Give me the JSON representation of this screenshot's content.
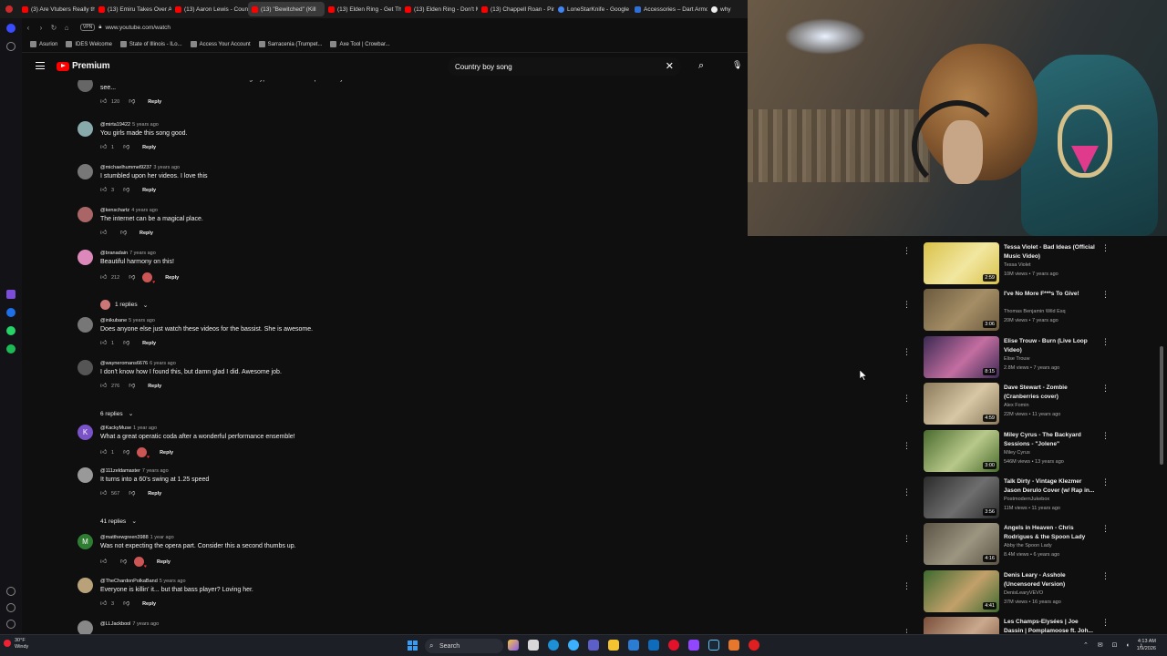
{
  "browser": {
    "tabs": [
      {
        "label": "(3) Are Vtubers Really the",
        "icon": "youtube"
      },
      {
        "label": "(13) Emiru Takes Over Ar",
        "icon": "youtube"
      },
      {
        "label": "(13) Aaron Lewis - Count",
        "icon": "youtube"
      },
      {
        "label": "(13) \"Bewitched\" (Kill",
        "icon": "youtube",
        "active": true
      },
      {
        "label": "(13) Elden Ring - Get Thes",
        "icon": "youtube"
      },
      {
        "label": "(13) Elden Ring - Don't Mi",
        "icon": "youtube"
      },
      {
        "label": "(13) Chappell Roan - Pink",
        "icon": "youtube"
      },
      {
        "label": "LoneStarKnife - Google S",
        "icon": "google"
      },
      {
        "label": "Accessories – Dart Armou",
        "icon": "site"
      },
      {
        "label": "why",
        "icon": "web"
      }
    ],
    "vpn_label": "VPN",
    "url": "www.youtube.com/watch",
    "bookmarks": [
      "Asurion",
      "IDES Welcome",
      "State of Illinois - ILo...",
      "Access Your Account",
      "Sarracenia (Trumpet...",
      "Axe Tool | Crowbar..."
    ]
  },
  "youtube": {
    "logo_text": "Premium",
    "search_value": "Country boy song"
  },
  "comments": [
    {
      "author": "",
      "ago": "",
      "text_lines": [
        "Them Dame's were throwin down a beat like a Chicago typewriter inside a speak easy at 2AM.",
        "see..."
      ],
      "likes": "120",
      "reply": "Reply",
      "hearted": false
    },
    {
      "author": "@mirta19422",
      "ago": "5 years ago",
      "text_lines": [
        "You girls made this song good."
      ],
      "likes": "1",
      "reply": "Reply",
      "hearted": false
    },
    {
      "author": "@michaelhummel9237",
      "ago": "3 years ago",
      "text_lines": [
        "I stumbled upon her videos. I love this"
      ],
      "likes": "3",
      "reply": "Reply",
      "hearted": false
    },
    {
      "author": "@kenschartz",
      "ago": "4 years ago",
      "text_lines": [
        "The internet can be a magical place."
      ],
      "likes": "",
      "reply": "Reply",
      "hearted": false
    },
    {
      "author": "@branadain",
      "ago": "7 years ago",
      "text_lines": [
        "Beautiful harmony on this!"
      ],
      "likes": "212",
      "reply": "Reply",
      "hearted": true,
      "replies": "1 replies"
    },
    {
      "author": "@inikubane",
      "ago": "5 years ago",
      "text_lines": [
        "Does anyone else just watch these videos for the bassist. She is awesome."
      ],
      "likes": "1",
      "reply": "Reply",
      "hearted": false
    },
    {
      "author": "@wayneromans6676",
      "ago": "6 years ago",
      "text_lines": [
        "I don't know how I found this, but damn glad I did. Awesome job."
      ],
      "likes": "276",
      "reply": "Reply",
      "hearted": false,
      "replies": "6 replies"
    },
    {
      "author": "@KackyMuse",
      "ago": "1 year ago",
      "text_lines": [
        "What a great operatic coda after a wonderful performance ensemble!"
      ],
      "likes": "1",
      "reply": "Reply",
      "hearted": true,
      "avatar_letter": "K"
    },
    {
      "author": "@111zeldamaster",
      "ago": "7 years ago",
      "text_lines": [
        "It turns into a 60's swing at 1.25 speed"
      ],
      "likes": "567",
      "reply": "Reply",
      "hearted": false,
      "replies": "41 replies"
    },
    {
      "author": "@matthewgreen3988",
      "ago": "1 year ago",
      "text_lines": [
        "Was not expecting the opera part. Consider this a second thumbs up."
      ],
      "likes": "",
      "reply": "Reply",
      "hearted": true,
      "avatar_letter": "M"
    },
    {
      "author": "@TheChardonPolkaBand",
      "ago": "5 years ago",
      "text_lines": [
        "Everyone is killin' it... but that bass player? Loving her."
      ],
      "likes": "3",
      "reply": "Reply",
      "hearted": false
    },
    {
      "author": "@LLJackbool",
      "ago": "7 years ago",
      "text_lines": [
        ""
      ],
      "likes": "",
      "reply": "",
      "hearted": false
    }
  ],
  "recommendations": [
    {
      "title": "Tessa Violet - Bad Ideas (Official Music Video)",
      "channel": "Tessa Violet",
      "verified": true,
      "meta": "10M views • 7 years ago",
      "duration": "2:59",
      "thumb_colors": [
        "#d9c24a",
        "#f2e7a1"
      ]
    },
    {
      "title": "I've No More F***s To Give!",
      "channel": "Thomas Benjamin Wild Esq",
      "verified": false,
      "meta": "20M views • 7 years ago",
      "duration": "3:06",
      "thumb_colors": [
        "#6b5a3e",
        "#a58e66"
      ]
    },
    {
      "title": "Elise Trouw - Burn (Live Loop Video)",
      "channel": "Elise Trouw",
      "verified": true,
      "meta": "2.8M views • 7 years ago",
      "duration": "8:15",
      "thumb_colors": [
        "#3b2a52",
        "#c46ea1"
      ]
    },
    {
      "title": "Dave Stewart - Zombie (Cranberries cover)",
      "channel": "Alex Fomin",
      "verified": false,
      "meta": "22M views • 11 years ago",
      "duration": "4:59",
      "thumb_colors": [
        "#8b7a5c",
        "#d8c7a4"
      ]
    },
    {
      "title": "Miley Cyrus - The Backyard Sessions - \"Jolene\"",
      "channel": "Miley Cyrus",
      "verified": true,
      "meta": "546M views • 13 years ago",
      "duration": "3:00",
      "thumb_colors": [
        "#4a6b2e",
        "#b8c98a"
      ]
    },
    {
      "title": "Talk Dirty - Vintage Klezmer Jason Derulo Cover (w/ Rap in...",
      "channel": "PostmodernJukebox",
      "verified": true,
      "meta": "11M views • 11 years ago",
      "duration": "3:56",
      "thumb_colors": [
        "#2b2b2b",
        "#6e6e6e"
      ]
    },
    {
      "title": "Angels in Heaven - Chris Rodrigues & the Spoon Lady",
      "channel": "Abby the Spoon Lady",
      "verified": true,
      "meta": "8.4M views • 6 years ago",
      "duration": "4:16",
      "thumb_colors": [
        "#5b5446",
        "#9c9580"
      ]
    },
    {
      "title": "Denis Leary - Asshole (Uncensored Version)",
      "channel": "DenisLearyVEVO",
      "verified": true,
      "meta": "37M views • 16 years ago",
      "duration": "4:41",
      "thumb_colors": [
        "#3e6a2f",
        "#c2a06a"
      ]
    },
    {
      "title": "Les Champs-Elysées | Joe Dassin | Pomplamoose ft. Joh...",
      "channel": "",
      "verified": false,
      "meta": "",
      "duration": "",
      "thumb_colors": [
        "#7a4f3a",
        "#c9a98e"
      ]
    }
  ],
  "taskbar": {
    "weather_temp": "30°F",
    "weather_desc": "Windy",
    "search_label": "Search",
    "time": "4:13 AM",
    "date": "1/9/2026"
  }
}
